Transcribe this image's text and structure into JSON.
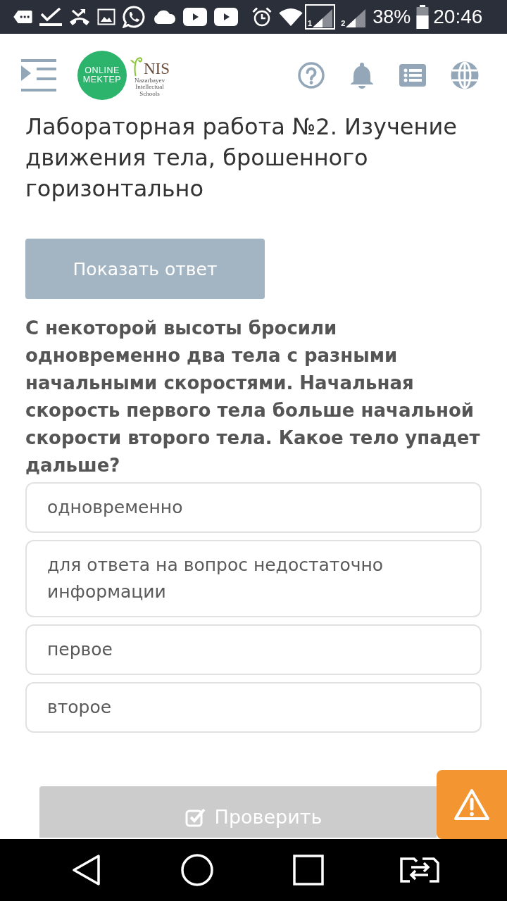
{
  "status_bar": {
    "sims": [
      {
        "label": "1",
        "selected": true
      },
      {
        "label": "2",
        "selected": false
      }
    ],
    "battery": "38%",
    "time": "20:46"
  },
  "header": {
    "logo": [
      "ONLINE",
      "MEKTEP"
    ],
    "partner_logo": {
      "name": "NIS",
      "subtitle": [
        "Nazarbayev",
        "Intellectual",
        "Schools"
      ]
    }
  },
  "title": "Лабораторная работа №2. Изучение движения тела, брошенного горизонтально",
  "show_answer_button": "Показать ответ",
  "question": "С некоторой высоты бросили одновременно два тела с разными начальными скоростями. Начальная скорость первого тела больше начальной скорости второго тела. Какое тело упадет дальше?",
  "options": [
    {
      "text": "одновременно",
      "selected": false
    },
    {
      "text": "для ответа на вопрос недостаточно информации",
      "selected": false
    },
    {
      "text": "первое",
      "selected": false
    },
    {
      "text": "второе",
      "selected": false
    }
  ],
  "check_button": {
    "label": "Проверить",
    "disabled": true
  }
}
